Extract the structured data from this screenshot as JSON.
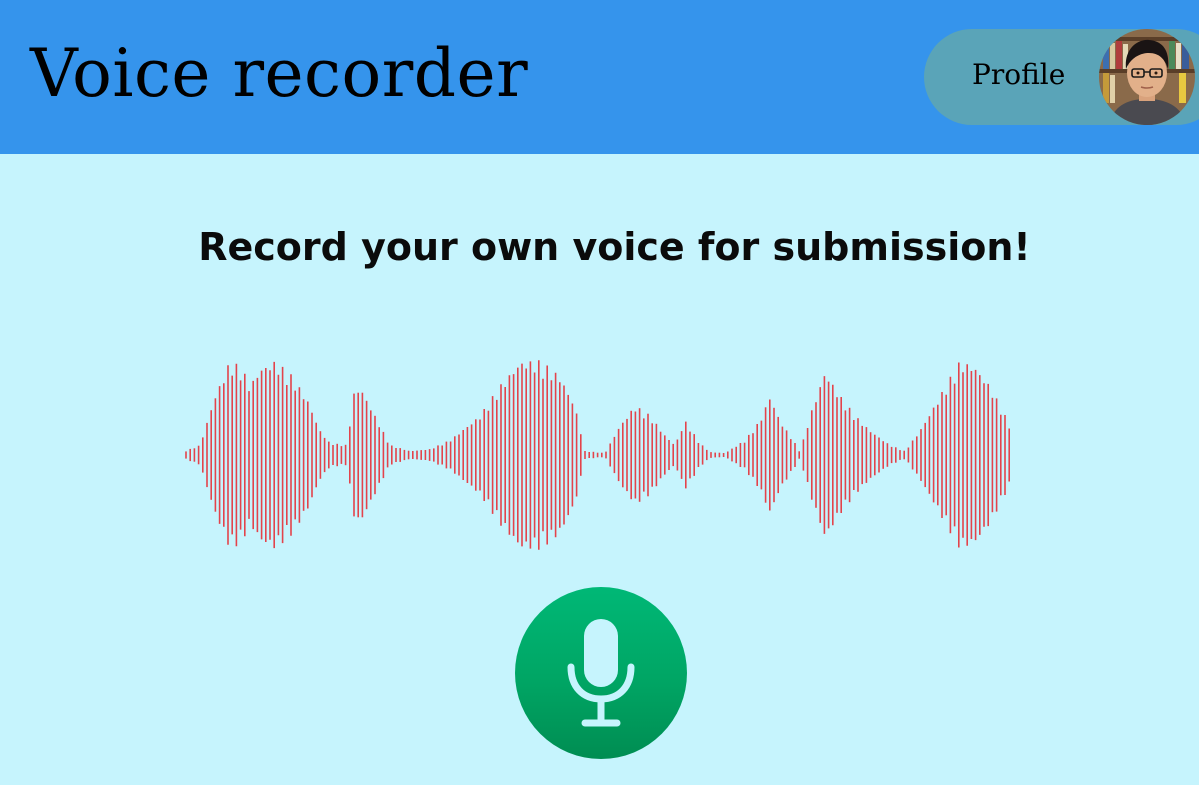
{
  "header": {
    "title": "Voice recorder",
    "profile_label": "Profile",
    "avatar_icon": "user-avatar-photo"
  },
  "main": {
    "headline": "Record your own voice for submission!",
    "waveform_color": "#e3434b",
    "mic_button_icon": "microphone-icon"
  },
  "colors": {
    "header_bg": "#3594ec",
    "page_bg": "#c6f4fd",
    "profile_pill_bg": "#5aa4b8",
    "mic_button_bg": "#00a564"
  }
}
